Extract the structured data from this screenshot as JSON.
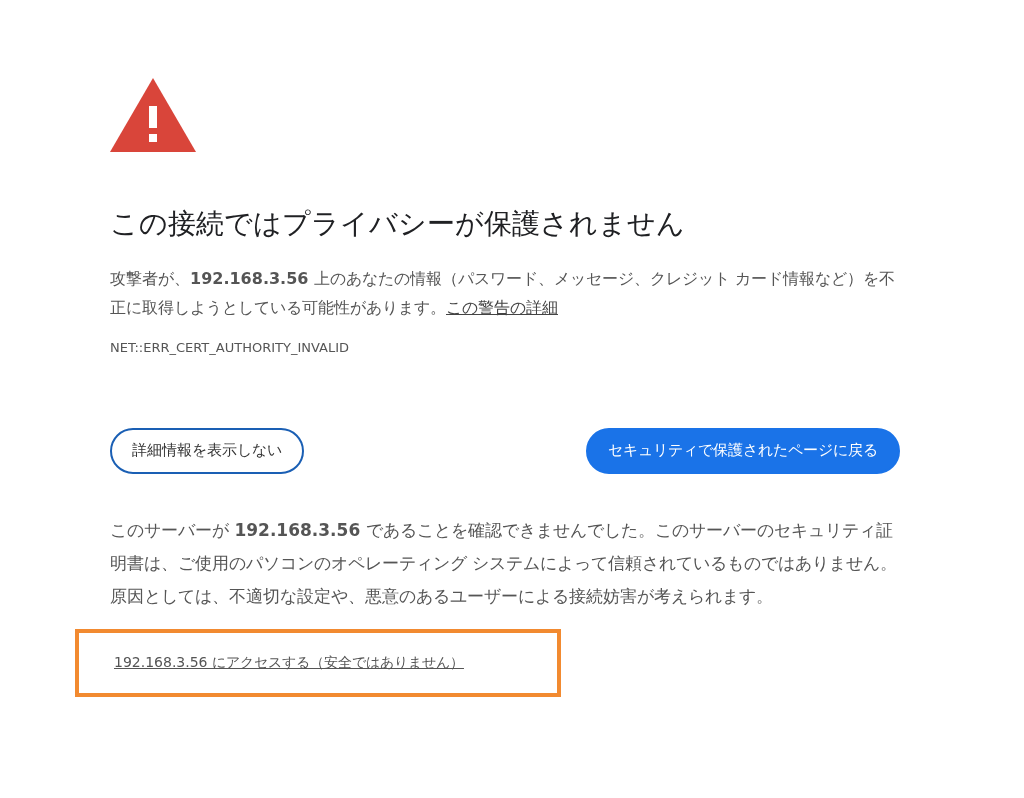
{
  "heading": "この接続ではプライバシーが保護されません",
  "summary": {
    "text": "攻撃者が、**192.168.3.56** 上のあなたの情報（パスワード、メッセージ、クレジット カード情報など）を不正に取得しようとしている可能性があります。",
    "link": "この警告の詳細"
  },
  "error_code": "NET::ERR_CERT_AUTHORITY_INVALID",
  "buttons": [
    {
      "label": "詳細情報を表示しない",
      "kind": "secondary"
    },
    {
      "label": "セキュリティで保護されたページに戻る",
      "kind": "primary"
    }
  ],
  "details": "このサーバーが **192.168.3.56** であることを確認できませんでした。このサーバーのセキュリティ証明書は、ご使用のパソコンのオペレーティング システムによって信頼されているものではありません。原因としては、不適切な設定や、悪意のあるユーザーによる接続妨害が考えられます。",
  "proceed_link": {
    "text": "192.168.3.56 にアクセスする（安全ではありません）",
    "highlighted": true
  }
}
